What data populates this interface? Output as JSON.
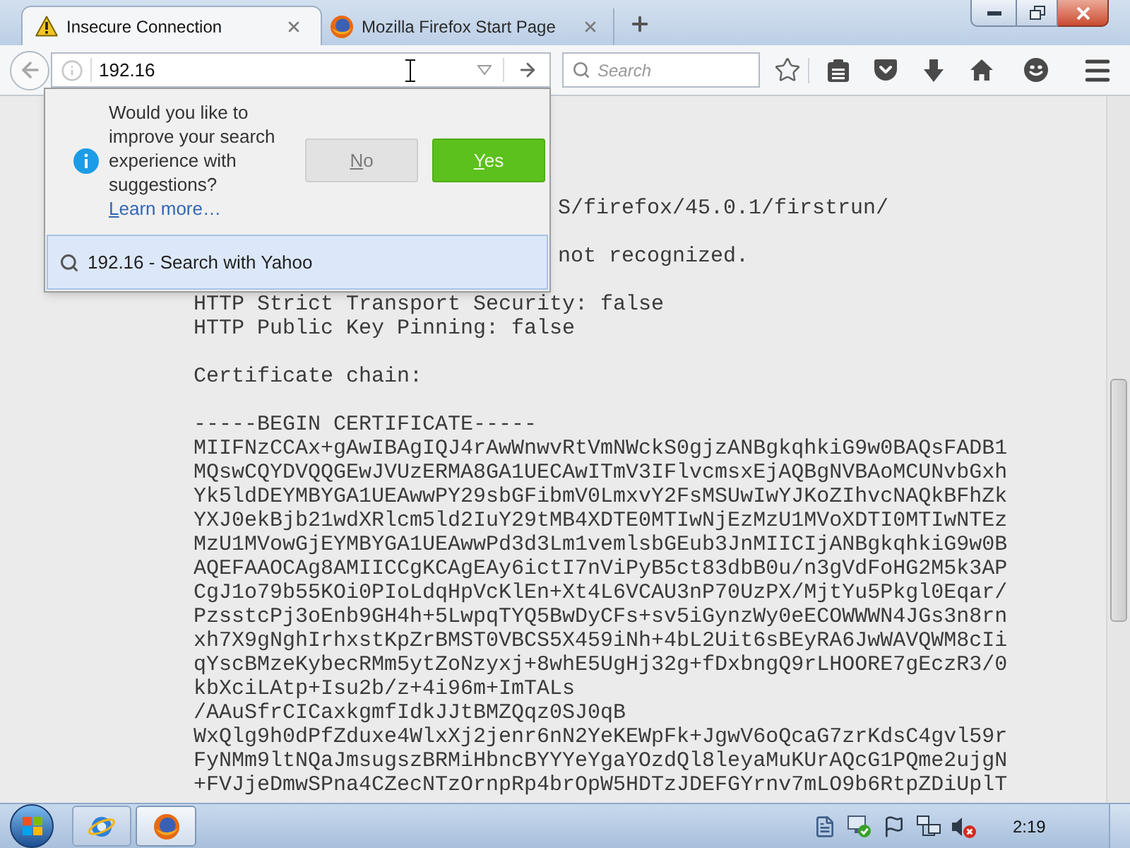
{
  "tabs": [
    {
      "label": "Insecure Connection",
      "kind": "warning",
      "selected": true
    },
    {
      "label": "Mozilla Firefox Start Page",
      "kind": "browser",
      "selected": false
    }
  ],
  "toolbar": {
    "address": {
      "value": "192.16"
    },
    "search": {
      "placeholder": "Search"
    }
  },
  "suggestion_prompt": {
    "message": "Would you like to improve your search experience with suggestions?",
    "link": "Learn more…",
    "buttons": [
      {
        "label": "No",
        "kind": "secondary"
      },
      {
        "label": "Yes",
        "kind": "primary"
      }
    ]
  },
  "autocomplete": [
    {
      "text": "192.16 - Search with Yahoo",
      "selected": true
    }
  ],
  "page": {
    "covered_lines": [
      "S/firefox/45.0.1/firstrun/",
      "not recognized."
    ],
    "security": [
      "HTTP Strict Transport Security: false",
      "HTTP Public Key Pinning: false"
    ],
    "heading": "Certificate chain:",
    "certificate": [
      "-----BEGIN CERTIFICATE-----",
      "MIIFNzCCAx+gAwIBAgIQJ4rAwWnwvRtVmNWckS0gjzANBgkqhkiG9w0BAQsFADB1",
      "MQswCQYDVQQGEwJVUzERMA8GA1UECAwITmV3IFlvcmsxEjAQBgNVBAoMCUNvbGxh",
      "Yk5ldDEYMBYGA1UEAwwPY29sbGFibmV0LmxvY2FsMSUwIwYJKoZIhvcNAQkBFhZk",
      "YXJ0ekBjb21wdXRlcm5ld2IuY29tMB4XDTE0MTIwNjEzMzU1MVoXDTI0MTIwNTEz",
      "MzU1MVowGjEYMBYGA1UEAwwPd3d3Lm1vemlsbGEub3JnMIICIjANBgkqhkiG9w0B",
      "AQEFAAOCAg8AMIICCgKCAgEAy6ictI7nViPyB5ct83dbB0u/n3gVdFoHG2M5k3AP",
      "CgJ1o79b55KOi0PIoLdqHpVcKlEn+Xt4L6VCAU3nP70UzPX/MjtYu5Pkgl0Eqar/",
      "PzsstcPj3oEnb9GH4h+5LwpqTYQ5BwDyCFs+sv5iGynzWy0eECOWWWN4JGs3n8rn",
      "xh7X9gNghIrhxstKpZrBMST0VBCS5X459iNh+4bL2Uit6sBEyRA6JwWAVQWM8cIi",
      "qYscBMzeKybecRMm5ytZoNzyxj+8whE5UgHj32g+fDxbngQ9rLHOORE7gEczR3/0",
      "kbXciLAtp+Isu2b/z+4i96m+ImTALs",
      "/AAuSfrCICaxkgmfIdkJJtBMZQqz0SJ0qB",
      "WxQlg9h0dPfZduxe4WlxXj2jenr6nN2YeKEWpFk+JgwV6oQcaG7zrKdsC4gvl59r",
      "FyNMm9ltNQaJmsugszBRMiHbncBYYYeYgaYOzdQl8leyaMuKUrAQcG1PQme2ujgN",
      "+FVJjeDmwSPna4CZecNTzOrnpRp4brOpW5HDTzJDEFGYrnv7mLO9b6RtpZDiUplT"
    ]
  },
  "taskbar": {
    "apps": [
      {
        "kind": "explorer",
        "selected": false
      },
      {
        "kind": "browser",
        "selected": true
      }
    ],
    "clock": "2:19"
  }
}
